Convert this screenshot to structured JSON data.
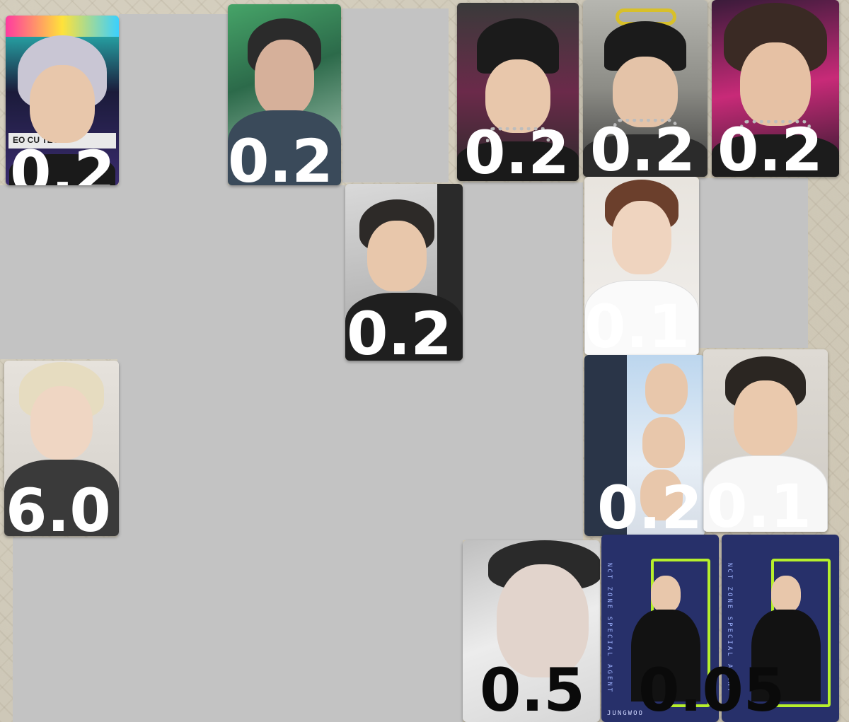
{
  "background": {
    "surface": "patterned fabric",
    "color": "#cec8b8"
  },
  "cards": [
    {
      "id": "card-1",
      "price": "0.2",
      "price_color": "white",
      "theme": "neon-teal",
      "hair_color": "#c9c6d4",
      "banner_text": "EO CU TECH"
    },
    {
      "id": "card-2",
      "price": "0.2",
      "price_color": "white",
      "theme": "green-holo",
      "hair_color": "#2b2b2b"
    },
    {
      "id": "card-3",
      "price": "0.2",
      "price_color": "white",
      "theme": "beanie-pink",
      "hair_color": "#1b1b1b"
    },
    {
      "id": "card-4",
      "price": "0.2",
      "price_color": "white",
      "theme": "beanie-grey",
      "hair_color": "#1b1b1b"
    },
    {
      "id": "card-5",
      "price": "0.2",
      "price_color": "white",
      "theme": "pink-neon",
      "hair_color": "#3a2a24"
    },
    {
      "id": "card-6",
      "price": "0.2",
      "price_color": "white",
      "theme": "black-jacket",
      "hair_color": "#2d2a28"
    },
    {
      "id": "card-7",
      "price": "0.1",
      "price_color": "white",
      "theme": "white-shirt",
      "hair_color": "#6b3f2c"
    },
    {
      "id": "card-8",
      "price": "6.0",
      "price_color": "white",
      "theme": "blonde-grey",
      "hair_color": "#e6dcc0"
    },
    {
      "id": "card-9",
      "price": "0.2",
      "price_color": "white",
      "theme": "group-of-three",
      "hair_color": "#2b2622"
    },
    {
      "id": "card-10",
      "price": "0.1",
      "price_color": "white",
      "theme": "white-shirt-pose",
      "hair_color": "#2b2622"
    },
    {
      "id": "card-11",
      "price": "0.5",
      "price_color": "black",
      "theme": "glitter-close-up",
      "hair_color": "#2a2a2a"
    },
    {
      "id": "card-12",
      "price": "0.05",
      "price_color": "black",
      "theme": "nct-zone-agent",
      "agent_text": "NCT ZONE SPECIAL AGENT",
      "name_text": "JUNGWOO"
    }
  ]
}
